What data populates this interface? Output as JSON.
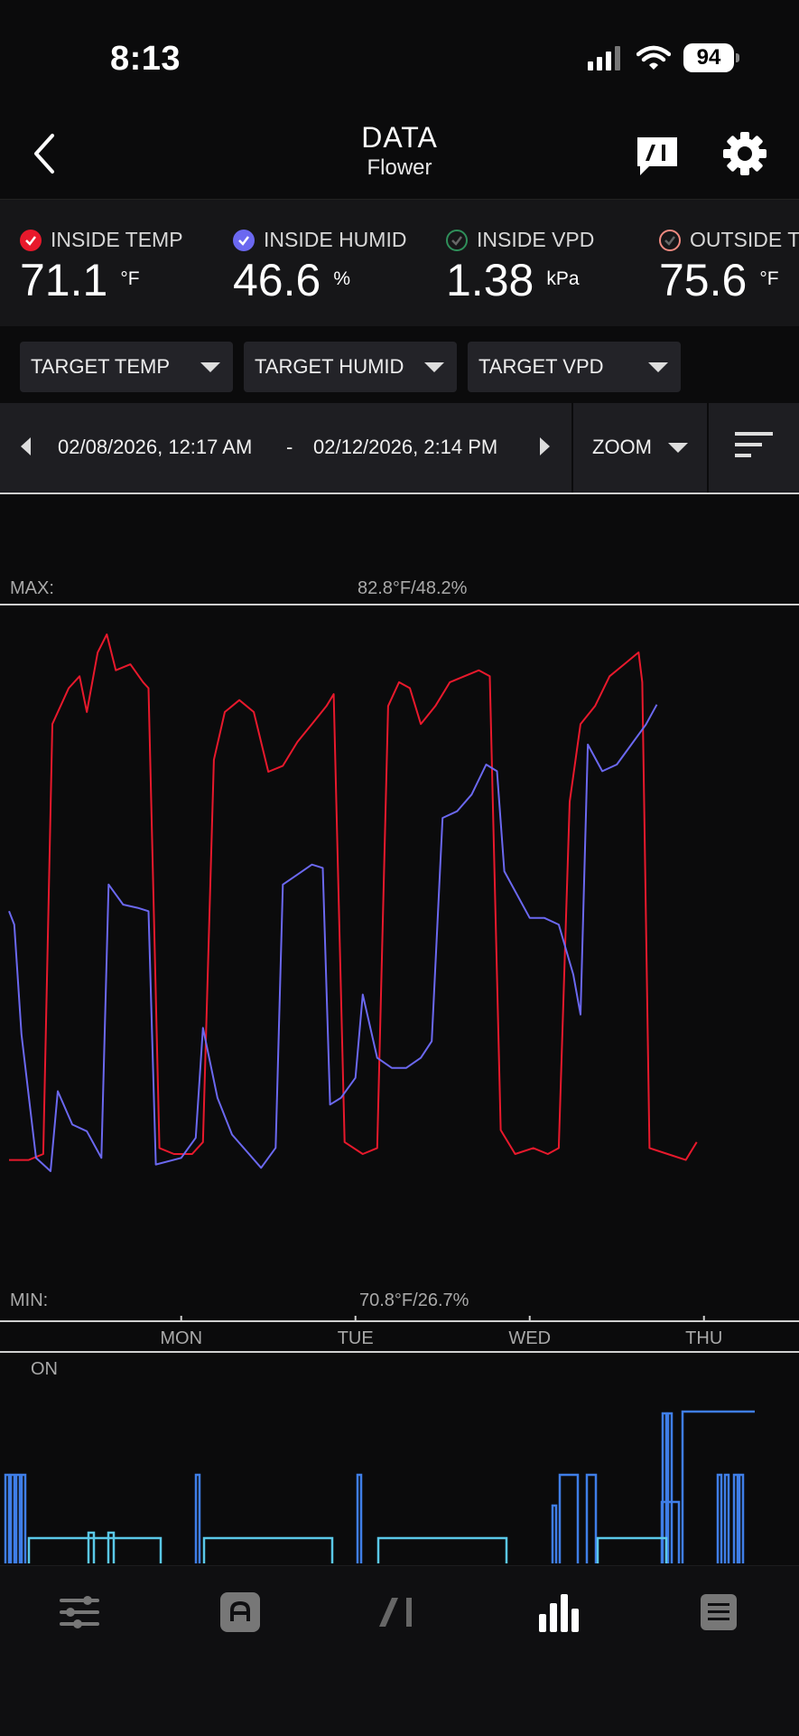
{
  "status_bar": {
    "time": "8:13",
    "battery": "94"
  },
  "header": {
    "title": "DATA",
    "subtitle": "Flower"
  },
  "sensors": [
    {
      "label": "INSIDE TEMP",
      "value": "71.1",
      "unit": "°F",
      "color": "#e8192c",
      "checked": true
    },
    {
      "label": "INSIDE HUMID",
      "value": "46.6",
      "unit": "%",
      "color": "#6b68f0",
      "checked": true
    },
    {
      "label": "INSIDE VPD",
      "value": "1.38",
      "unit": "kPa",
      "color": "#2f8f5a",
      "checked": false
    },
    {
      "label": "OUTSIDE T",
      "value": "75.6",
      "unit": "°F",
      "color": "#f08a80",
      "checked": false
    }
  ],
  "targets": [
    "TARGET TEMP",
    "TARGET HUMID",
    "TARGET VPD"
  ],
  "range": {
    "start": "02/08/2026, 12:17 AM",
    "dash": "-",
    "end": "02/12/2026, 2:14 PM",
    "zoom_label": "ZOOM"
  },
  "chart_labels": {
    "max_label": "MAX:",
    "max_value": "82.8°F/48.2%",
    "min_label": "MIN:",
    "min_value": "70.8°F/26.7%",
    "on_label": "ON"
  },
  "chart_data": {
    "type": "line",
    "x_axis": {
      "ticks": [
        "MON",
        "TUE",
        "WED",
        "THU"
      ],
      "range": [
        "02/08/2026, 12:17 AM",
        "02/12/2026, 2:14 PM"
      ]
    },
    "y_left": {
      "label": "°F",
      "range": [
        70.8,
        82.8
      ]
    },
    "y_right": {
      "label": "%",
      "range": [
        26.7,
        48.2
      ]
    },
    "series": [
      {
        "name": "INSIDE TEMP",
        "color": "#e8192c",
        "axis": "left",
        "points": [
          [
            "Sun 00:17",
            73.5
          ],
          [
            "Sun 03:00",
            73.5
          ],
          [
            "Sun 05:00",
            73.6
          ],
          [
            "Sun 06:15",
            80.8
          ],
          [
            "Sun 08:30",
            81.4
          ],
          [
            "Sun 10:00",
            81.6
          ],
          [
            "Sun 11:00",
            81.0
          ],
          [
            "Sun 12:30",
            82.0
          ],
          [
            "Sun 13:45",
            82.3
          ],
          [
            "Sun 15:00",
            81.7
          ],
          [
            "Sun 17:00",
            81.8
          ],
          [
            "Sun 18:45",
            81.5
          ],
          [
            "Sun 19:30",
            81.4
          ],
          [
            "Sun 21:00",
            73.7
          ],
          [
            "Sun 23:00",
            73.6
          ],
          [
            "Mon 01:30",
            73.6
          ],
          [
            "Mon 03:00",
            73.8
          ],
          [
            "Mon 04:30",
            80.2
          ],
          [
            "Mon 06:00",
            81.0
          ],
          [
            "Mon 08:00",
            81.2
          ],
          [
            "Mon 10:00",
            81.0
          ],
          [
            "Mon 12:00",
            80.0
          ],
          [
            "Mon 14:00",
            80.1
          ],
          [
            "Mon 16:00",
            80.5
          ],
          [
            "Mon 18:00",
            80.8
          ],
          [
            "Mon 20:00",
            81.1
          ],
          [
            "Mon 21:00",
            81.3
          ],
          [
            "Mon 22:30",
            73.8
          ],
          [
            "Tue 01:00",
            73.6
          ],
          [
            "Tue 03:00",
            73.7
          ],
          [
            "Tue 04:30",
            81.1
          ],
          [
            "Tue 06:00",
            81.5
          ],
          [
            "Tue 07:30",
            81.4
          ],
          [
            "Tue 09:00",
            80.8
          ],
          [
            "Tue 11:00",
            81.1
          ],
          [
            "Tue 13:00",
            81.5
          ],
          [
            "Tue 15:00",
            81.6
          ],
          [
            "Tue 17:00",
            81.7
          ],
          [
            "Tue 18:30",
            81.6
          ],
          [
            "Tue 20:00",
            74.0
          ],
          [
            "Tue 22:00",
            73.6
          ],
          [
            "Wed 00:30",
            73.7
          ],
          [
            "Wed 02:30",
            73.6
          ],
          [
            "Wed 04:00",
            73.7
          ],
          [
            "Wed 05:30",
            79.5
          ],
          [
            "Wed 07:00",
            80.8
          ],
          [
            "Wed 09:00",
            81.1
          ],
          [
            "Wed 11:00",
            81.6
          ],
          [
            "Wed 13:00",
            81.8
          ],
          [
            "Wed 15:00",
            82.0
          ],
          [
            "Wed 15:30",
            81.5
          ],
          [
            "Wed 16:30",
            73.7
          ],
          [
            "Wed 19:00",
            73.6
          ],
          [
            "Wed 21:30",
            73.5
          ],
          [
            "Wed 23:00",
            73.8
          ]
        ]
      },
      {
        "name": "INSIDE HUMID",
        "color": "#6b68f0",
        "axis": "right",
        "points": [
          [
            "Sun 00:17",
            39.0
          ],
          [
            "Sun 01:00",
            38.6
          ],
          [
            "Sun 02:00",
            35.3
          ],
          [
            "Sun 04:00",
            31.6
          ],
          [
            "Sun 06:00",
            31.2
          ],
          [
            "Sun 07:00",
            33.6
          ],
          [
            "Sun 09:00",
            32.6
          ],
          [
            "Sun 11:00",
            32.4
          ],
          [
            "Sun 13:00",
            31.6
          ],
          [
            "Sun 14:00",
            39.8
          ],
          [
            "Sun 16:00",
            39.2
          ],
          [
            "Sun 18:00",
            39.1
          ],
          [
            "Sun 19:30",
            39.0
          ],
          [
            "Sun 20:30",
            31.4
          ],
          [
            "Mon 00:00",
            31.6
          ],
          [
            "Mon 02:00",
            32.2
          ],
          [
            "Mon 03:00",
            35.5
          ],
          [
            "Mon 05:00",
            33.4
          ],
          [
            "Mon 07:00",
            32.3
          ],
          [
            "Mon 09:00",
            31.8
          ],
          [
            "Mon 11:00",
            31.3
          ],
          [
            "Mon 13:00",
            31.9
          ],
          [
            "Mon 14:00",
            39.8
          ],
          [
            "Mon 16:00",
            40.1
          ],
          [
            "Mon 18:00",
            40.4
          ],
          [
            "Mon 19:30",
            40.3
          ],
          [
            "Mon 20:30",
            33.2
          ],
          [
            "Mon 22:00",
            33.4
          ],
          [
            "Tue 00:00",
            34.0
          ],
          [
            "Tue 01:00",
            36.5
          ],
          [
            "Tue 03:00",
            34.6
          ],
          [
            "Tue 05:00",
            34.3
          ],
          [
            "Tue 07:00",
            34.3
          ],
          [
            "Tue 09:00",
            34.6
          ],
          [
            "Tue 10:30",
            35.1
          ],
          [
            "Tue 12:00",
            41.8
          ],
          [
            "Tue 14:00",
            42.0
          ],
          [
            "Tue 16:00",
            42.5
          ],
          [
            "Tue 18:00",
            43.4
          ],
          [
            "Tue 19:30",
            43.2
          ],
          [
            "Tue 20:30",
            40.2
          ],
          [
            "Wed 00:00",
            38.8
          ],
          [
            "Wed 02:00",
            38.8
          ],
          [
            "Wed 04:00",
            38.6
          ],
          [
            "Wed 06:00",
            37.1
          ],
          [
            "Wed 07:00",
            35.9
          ],
          [
            "Wed 08:00",
            44.0
          ],
          [
            "Wed 10:00",
            43.2
          ],
          [
            "Wed 12:00",
            43.4
          ],
          [
            "Wed 14:00",
            44.0
          ],
          [
            "Wed 16:00",
            44.6
          ],
          [
            "Wed 17:30",
            45.2
          ]
        ]
      }
    ],
    "device_activity": {
      "label": "ON",
      "color_primary": "#3f7ee8",
      "color_secondary": "#5ac8e8"
    }
  }
}
